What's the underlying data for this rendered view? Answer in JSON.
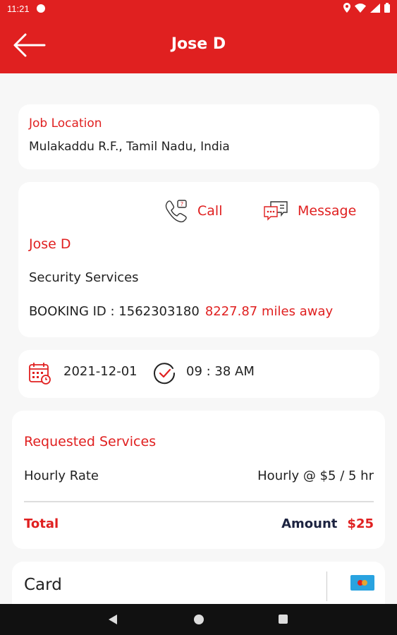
{
  "status_bar": {
    "time": "11:21"
  },
  "app_bar": {
    "title": "Jose D"
  },
  "job_location": {
    "label": "Job Location",
    "value": "Mulakaddu R.F., Tamil Nadu, India"
  },
  "contact": {
    "call_label": "Call",
    "message_label": "Message",
    "name": "Jose D",
    "service": "Security Services",
    "booking_id": "BOOKING ID : 1562303180",
    "distance": "8227.87 miles away"
  },
  "schedule": {
    "date": "2021-12-01",
    "time": "09 : 38 AM"
  },
  "requested_services": {
    "title": "Requested Services",
    "items": [
      {
        "label": "Hourly Rate",
        "value": "Hourly @ $5 / 5 hr"
      }
    ],
    "total_label": "Total",
    "amount_label": "Amount",
    "amount_value": "$25"
  },
  "payment": {
    "method_label": "Card",
    "icon": "card-icon"
  },
  "colors": {
    "accent": "#e02020",
    "navy": "#1c2340"
  }
}
